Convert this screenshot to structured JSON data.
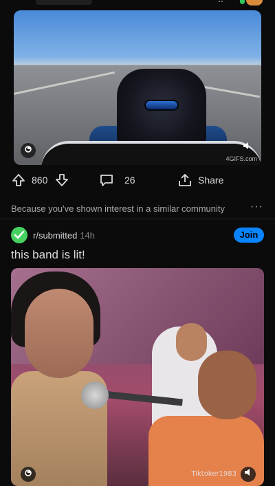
{
  "post1": {
    "media_watermark": "4GIFS.com",
    "actions": {
      "upvotes": "860",
      "comments": "26",
      "share_label": "Share"
    }
  },
  "recommendation": {
    "reason_text": "Because you've shown interest in a similar community",
    "more_label": "···"
  },
  "post2": {
    "subreddit": "r/submitted",
    "age": "14h",
    "join_label": "Join",
    "title": "this band is lit!",
    "media_watermark": "Tiktoker1983"
  },
  "colors": {
    "background": "#0b0b0c",
    "text": "#d7dadc",
    "muted": "#818384",
    "join_button": "#0a84ff",
    "subreddit_icon": "#46d160"
  },
  "icons": [
    "upvote-icon",
    "downvote-icon",
    "comment-icon",
    "share-icon",
    "gif-badge-icon",
    "mute-icon",
    "checkmark-icon"
  ]
}
